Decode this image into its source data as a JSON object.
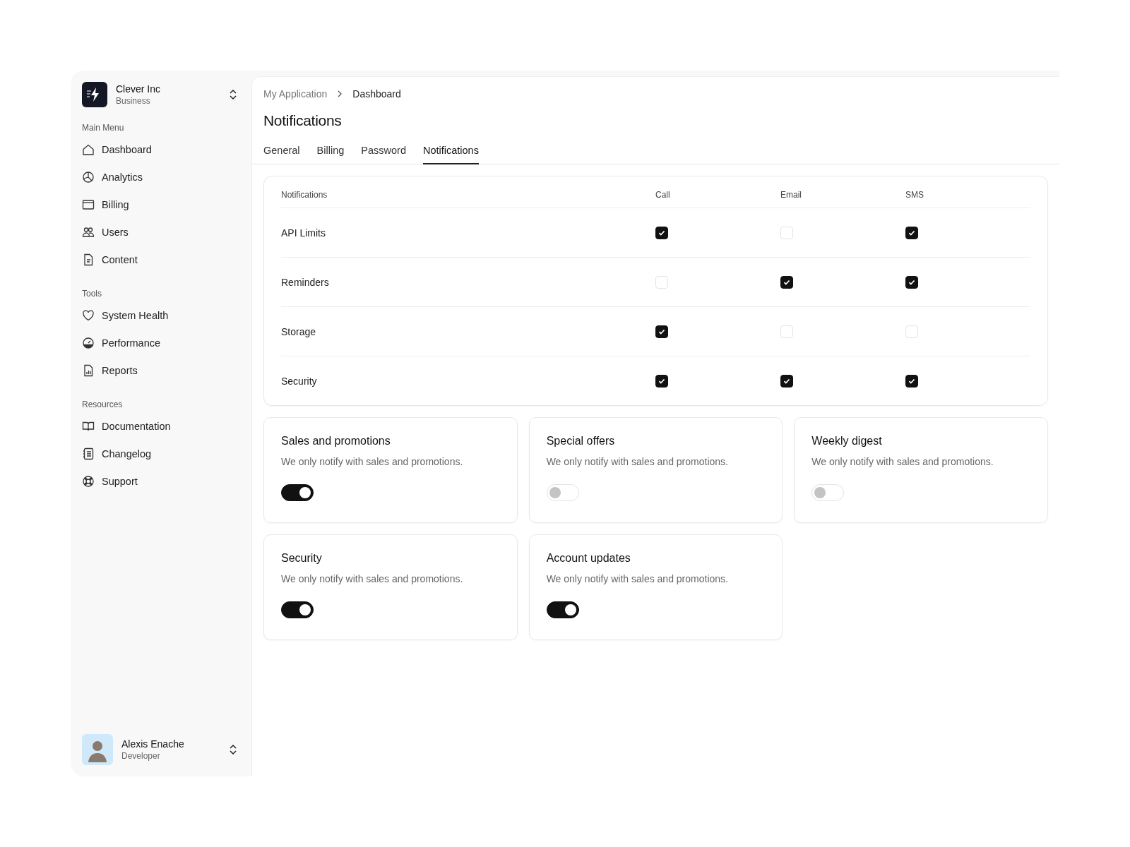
{
  "workspace": {
    "name": "Clever Inc",
    "plan": "Business"
  },
  "sidebar": {
    "sections": [
      {
        "title": "Main Menu",
        "items": [
          {
            "label": "Dashboard"
          },
          {
            "label": "Analytics"
          },
          {
            "label": "Billing"
          },
          {
            "label": "Users"
          },
          {
            "label": "Content"
          }
        ]
      },
      {
        "title": "Tools",
        "items": [
          {
            "label": "System Health"
          },
          {
            "label": "Performance"
          },
          {
            "label": "Reports"
          }
        ]
      },
      {
        "title": "Resources",
        "items": [
          {
            "label": "Documentation"
          },
          {
            "label": "Changelog"
          },
          {
            "label": "Support"
          }
        ]
      }
    ]
  },
  "user": {
    "name": "Alexis Enache",
    "role": "Developer"
  },
  "breadcrumb": [
    "My Application",
    "Dashboard"
  ],
  "title": "Notifications",
  "tabs": [
    {
      "label": "General",
      "selected": false
    },
    {
      "label": "Billing",
      "selected": false
    },
    {
      "label": "Password",
      "selected": false
    },
    {
      "label": "Notifications",
      "selected": true
    }
  ],
  "table": {
    "columns": [
      "Notifications",
      "Call",
      "Email",
      "SMS"
    ],
    "rows": [
      {
        "label": "API Limits",
        "channels": [
          {
            "checked": true
          },
          {
            "checked": false
          },
          {
            "checked": true
          }
        ]
      },
      {
        "label": "Reminders",
        "channels": [
          {
            "checked": false
          },
          {
            "checked": true
          },
          {
            "checked": true
          }
        ]
      },
      {
        "label": "Storage",
        "channels": [
          {
            "checked": true
          },
          {
            "checked": false
          },
          {
            "checked": false
          }
        ]
      },
      {
        "label": "Security",
        "channels": [
          {
            "checked": true
          },
          {
            "checked": true
          },
          {
            "checked": true
          }
        ]
      }
    ]
  },
  "cards": [
    {
      "title": "Sales and promotions",
      "description": "We only notify with sales and promotions.",
      "on": true
    },
    {
      "title": "Special offers",
      "description": "We only notify with sales and promotions.",
      "on": false
    },
    {
      "title": "Weekly digest",
      "description": "We only notify with sales and promotions.",
      "on": false
    },
    {
      "title": "Security",
      "description": "We only notify with sales and promotions.",
      "on": true
    },
    {
      "title": "Account updates",
      "description": "We only notify with sales and promotions.",
      "on": true
    }
  ]
}
